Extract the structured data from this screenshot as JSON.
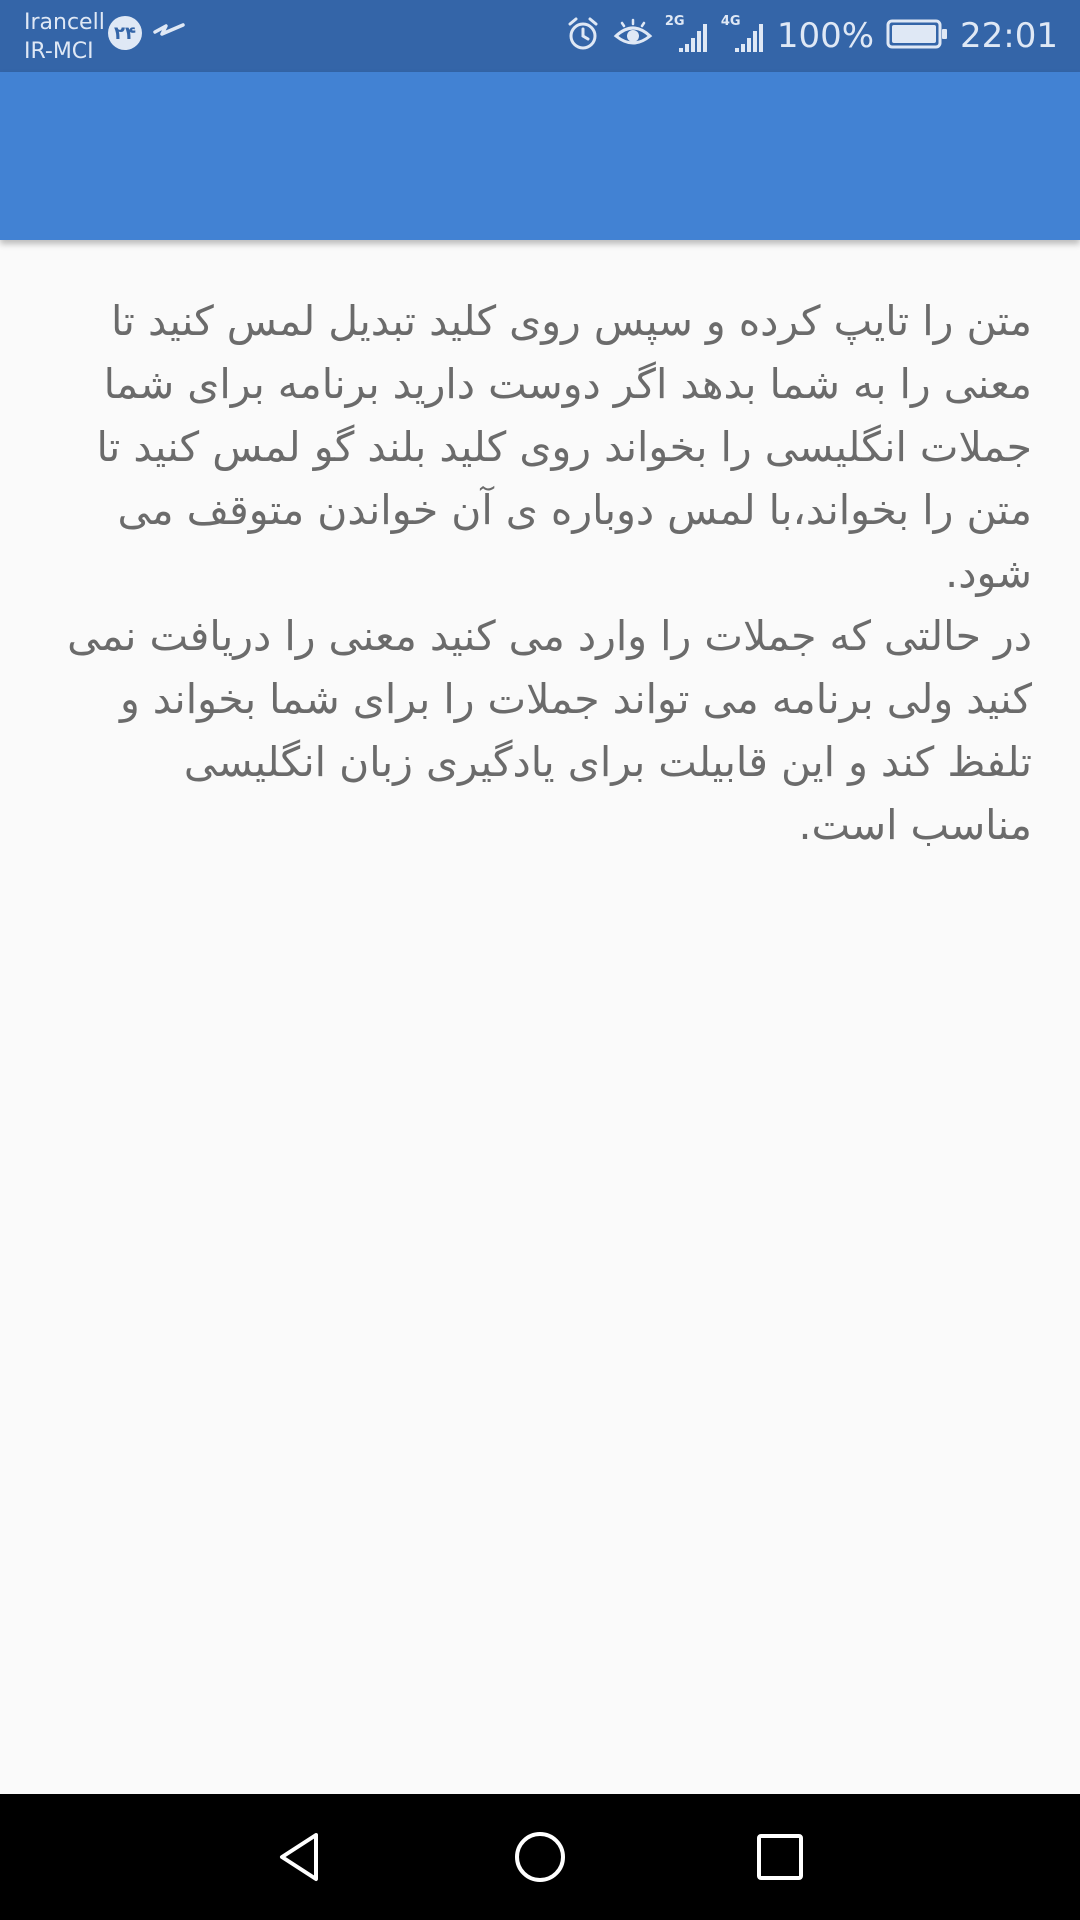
{
  "status_bar": {
    "carrier_1": "Irancell",
    "carrier_2": "IR-MCI",
    "badge_text": "۲۴",
    "battery_percent": "100%",
    "time": "22:01",
    "network_1": "2G",
    "network_2": "4G",
    "icons": [
      "alarm-icon",
      "eye-comfort-icon",
      "signal-icon",
      "battery-icon",
      "notification-icon"
    ],
    "colors": {
      "background": "#3465a8",
      "foreground": "#dfe8f5"
    }
  },
  "app_bar": {
    "color": "#4282d3"
  },
  "main": {
    "body_text": "متن را تایپ کرده و سپس روی کلید تبدیل لمس کنید تا معنی را به شما بدهد اگر دوست دارید برنامه برای شما جملات انگلیسی را بخواند روی کلید بلند گو لمس کنید تا متن را بخواند،با لمس دوباره ی آن خواندن متوقف می شود.\n در حالتی که جملات را وارد می کنید معنی را دریافت نمی کنید ولی برنامه می تواند جملات را برای شما بخواند و تلفظ کند و این قابیلت برای یادگیری زبان انگلیسی مناسب است."
  },
  "nav_bar": {
    "buttons": [
      "back-icon",
      "home-icon",
      "recents-icon"
    ]
  }
}
